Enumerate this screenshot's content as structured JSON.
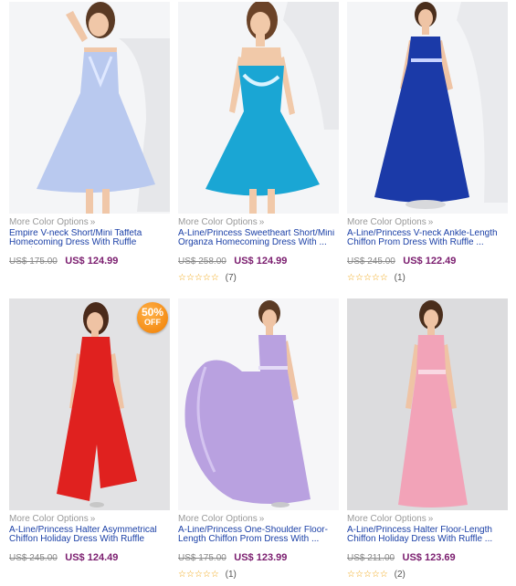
{
  "colors": {
    "link": "#1a3fa6",
    "price": "#7a1c6e",
    "muted": "#999999",
    "star": "#f0a30a",
    "badge": "#f07d00"
  },
  "products": [
    {
      "more_options": "More Color Options",
      "name": "Empire V-neck Short/Mini Taffeta Homecoming Dress With Ruffle Sequins",
      "old_price": "US$ 175.00",
      "price": "US$ 124.99",
      "rating_count": "",
      "dress_color": "#b9c9ef",
      "badge": ""
    },
    {
      "more_options": "More Color Options",
      "name": "A-Line/Princess Sweetheart Short/Mini Organza Homecoming Dress With ...",
      "old_price": "US$ 258.00",
      "price": "US$ 124.99",
      "rating_count": "(7)",
      "dress_color": "#1aa6d4",
      "badge": ""
    },
    {
      "more_options": "More Color Options",
      "name": "A-Line/Princess V-neck Ankle-Length Chiffon Prom Dress With Ruffle ...",
      "old_price": "US$ 245.00",
      "price": "US$ 122.49",
      "rating_count": "(1)",
      "dress_color": "#1b3aa8",
      "badge": ""
    },
    {
      "more_options": "More Color Options",
      "name": "A-Line/Princess Halter Asymmetrical Chiffon Holiday Dress With Ruffle",
      "old_price": "US$ 245.00",
      "price": "US$ 124.49",
      "rating_count": "",
      "dress_color": "#e0211f",
      "badge": "50%|OFF"
    },
    {
      "more_options": "More Color Options",
      "name": "A-Line/Princess One-Shoulder Floor-Length Chiffon Prom Dress With ...",
      "old_price": "US$ 175.00",
      "price": "US$ 123.99",
      "rating_count": "(1)",
      "dress_color": "#b9a1e0",
      "badge": ""
    },
    {
      "more_options": "More Color Options",
      "name": "A-Line/Princess Halter Floor-Length Chiffon Holiday Dress With Ruffle ...",
      "old_price": "US$ 211.00",
      "price": "US$ 123.69",
      "rating_count": "(2)",
      "dress_color": "#f2a3b8",
      "badge": ""
    }
  ],
  "rating_stars": 5,
  "chevron": "»",
  "badge_text": {
    "pct": "50%",
    "off": "OFF"
  }
}
